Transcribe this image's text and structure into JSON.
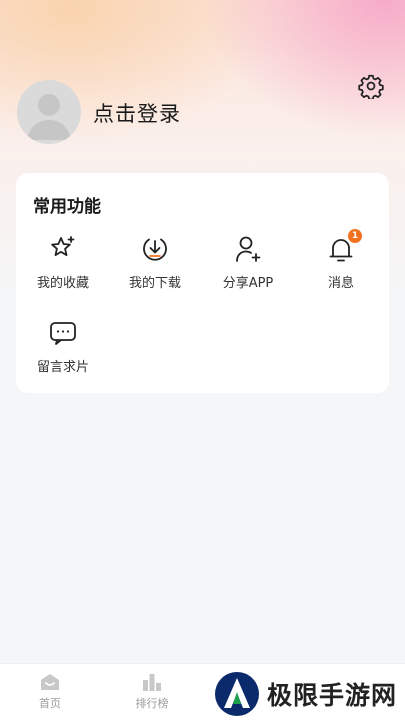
{
  "profile": {
    "login_text": "点击登录"
  },
  "functions": {
    "title": "常用功能",
    "items": [
      {
        "label": "我的收藏",
        "icon": "star-sparkle-icon"
      },
      {
        "label": "我的下载",
        "icon": "download-icon"
      },
      {
        "label": "分享APP",
        "icon": "user-add-icon"
      },
      {
        "label": "消息",
        "icon": "bell-icon",
        "badge": "1"
      },
      {
        "label": "留言求片",
        "icon": "message-dots-icon"
      }
    ]
  },
  "tabbar": {
    "items": [
      {
        "label": "首页",
        "icon": "home-icon"
      },
      {
        "label": "排行榜",
        "icon": "ranking-icon"
      }
    ]
  },
  "watermark": {
    "text": "极限手游网"
  },
  "colors": {
    "badge": "#f4721e",
    "brand_green": "#1aa04a",
    "brand_navy": "#0b2a6b"
  }
}
